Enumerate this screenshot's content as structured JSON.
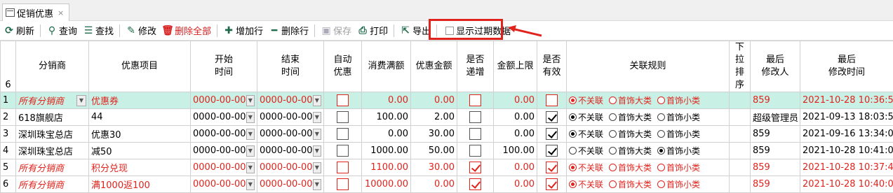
{
  "tab": {
    "label": "促销优惠",
    "close": "×"
  },
  "toolbar": {
    "refresh": "刷新",
    "query": "查询",
    "find": "查找",
    "edit": "修改",
    "delete_all": "删除全部",
    "add_row": "增加行",
    "delete_row": "删除行",
    "save": "保存",
    "print": "打印",
    "export": "导出",
    "show_expired": "显示过期数据"
  },
  "table": {
    "corner": "6",
    "headers": {
      "distributor": "分销商",
      "item": "优惠项目",
      "start": "开始\n时间",
      "end": "结束\n时间",
      "auto": "自动\n优惠",
      "threshold": "消费满额",
      "amount": "优惠金额",
      "incr": "是否\n递增",
      "cap": "金额上限",
      "valid": "是否\n有效",
      "rule": "关联规则",
      "order": "下拉\n排序",
      "modifier": "最后\n修改人",
      "modtime": "最后\n修改时间"
    },
    "radio_labels": [
      "不关联",
      "首饰大类",
      "首饰小类"
    ],
    "rows": [
      {
        "no": "1",
        "distributor": "所有分销商",
        "item": "优惠券",
        "start": "0000-00-00",
        "end": "0000-00-00",
        "auto": false,
        "threshold": "0.00",
        "amount": "0.00",
        "incr": false,
        "cap": "0.00",
        "valid": false,
        "rule": 0,
        "order": "",
        "modifier": "859",
        "modtime": "2021-10-28 10:36:52"
      },
      {
        "no": "2",
        "distributor": "618旗舰店",
        "item": "44",
        "start": "0000-00-00",
        "end": "0000-00-00",
        "auto": false,
        "threshold": "100.00",
        "amount": "2.00",
        "incr": false,
        "cap": "0.00",
        "valid": true,
        "rule": 0,
        "order": "",
        "modifier": "超级管理员",
        "modtime": "2021-09-13 18:03:54"
      },
      {
        "no": "3",
        "distributor": "深圳珠宝总店",
        "item": "优惠30",
        "start": "0000-00-00",
        "end": "0000-00-00",
        "auto": false,
        "threshold": "0.00",
        "amount": "30.00",
        "incr": false,
        "cap": "0.00",
        "valid": true,
        "rule": 0,
        "order": "",
        "modifier": "859",
        "modtime": "2021-09-16 13:34:01"
      },
      {
        "no": "4",
        "distributor": "深圳珠宝总店",
        "item": "减50",
        "start": "0000-00-00",
        "end": "0000-00-00",
        "auto": false,
        "threshold": "1000.00",
        "amount": "50.00",
        "incr": false,
        "cap": "100.00",
        "valid": true,
        "rule": 2,
        "order": "",
        "modifier": "859",
        "modtime": "2021-10-28 10:41:05"
      },
      {
        "no": "5",
        "distributor": "所有分销商",
        "item": "积分兑现",
        "start": "0000-00-00",
        "end": "0000-00-00",
        "auto": false,
        "threshold": "1100.00",
        "amount": "30.00",
        "incr": true,
        "cap": "0.00",
        "valid": true,
        "rule": 0,
        "order": "",
        "modifier": "859",
        "modtime": "2021-10-28 10:37:46"
      },
      {
        "no": "6",
        "distributor": "所有分销商",
        "item": "满1000返100",
        "start": "0000-00-00",
        "end": "0000-00-00",
        "auto": false,
        "threshold": "10000.00",
        "amount": "0.00",
        "incr": true,
        "cap": "0.00",
        "valid": true,
        "rule": 0,
        "order": "",
        "modifier": "859",
        "modtime": "2021-10-28 10:40:01"
      }
    ]
  },
  "colors": {
    "accent_red": "#e0231c",
    "selected_row": "#c8f0e4",
    "icon_green": "#1e6a4a"
  }
}
